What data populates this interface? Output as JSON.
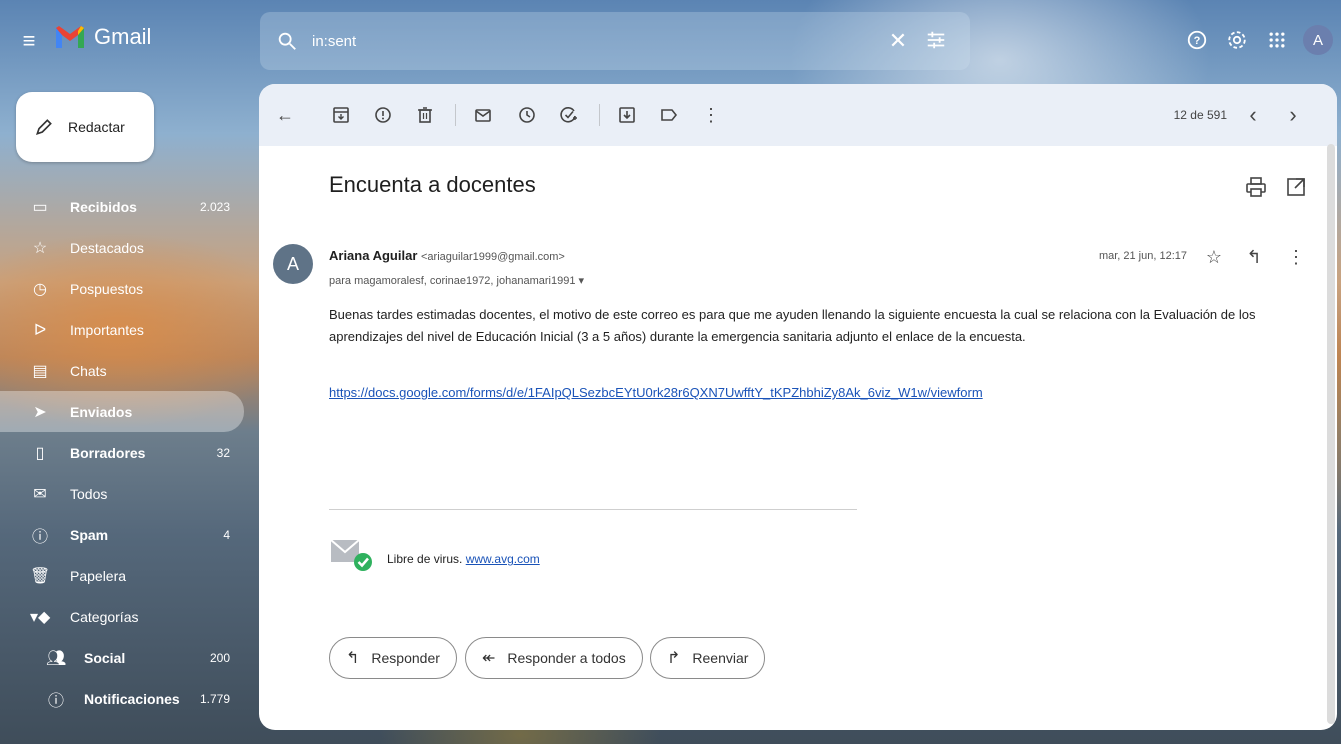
{
  "app": {
    "name": "Gmail",
    "avatar_letter": "A"
  },
  "search": {
    "value": "in:sent",
    "icon": "search-icon"
  },
  "top_icons": [
    "help-icon",
    "settings-icon",
    "apps-grid-icon"
  ],
  "compose": {
    "label": "Redactar"
  },
  "sidebar": {
    "items": [
      {
        "label": "Recibidos",
        "count": "2.023",
        "icon": "inbox-icon",
        "bold": true
      },
      {
        "label": "Destacados",
        "count": "",
        "icon": "star-icon"
      },
      {
        "label": "Pospuestos",
        "count": "",
        "icon": "clock-icon"
      },
      {
        "label": "Importantes",
        "count": "",
        "icon": "important-icon"
      },
      {
        "label": "Chats",
        "count": "",
        "icon": "chat-icon"
      },
      {
        "label": "Enviados",
        "count": "",
        "icon": "send-icon",
        "bold": true,
        "active": true
      },
      {
        "label": "Borradores",
        "count": "32",
        "icon": "draft-icon",
        "bold": true
      },
      {
        "label": "Todos",
        "count": "",
        "icon": "mail-icon"
      },
      {
        "label": "Spam",
        "count": "4",
        "icon": "spam-icon",
        "bold": true
      },
      {
        "label": "Papelera",
        "count": "",
        "icon": "trash-icon"
      },
      {
        "label": "Categorías",
        "count": "",
        "icon": "label-icon"
      },
      {
        "label": "Social",
        "count": "200",
        "icon": "people-icon",
        "sub": true
      },
      {
        "label": "Notificaciones",
        "count": "1.779",
        "icon": "info-icon",
        "sub": true
      }
    ]
  },
  "toolbar": {
    "pager": "12 de 591"
  },
  "email": {
    "subject": "Encuenta a docentes",
    "sender_initial": "A",
    "sender_name": "Ariana Aguilar",
    "sender_email": "<ariaguilar1999@gmail.com>",
    "to": "para magamoralesf, corinae1972, johanamari1991 ▾",
    "date": "mar, 21 jun, 12:17",
    "body": "Buenas tardes estimadas docentes, el motivo de este correo es para que me  ayuden llenando la siguiente encuesta la cual se relaciona con la  Evaluación de los aprendizajes del nivel de Educación Inicial (3 a 5 años) durante la emergencia sanitaria adjunto el enlace de la encuesta.",
    "link": "https://docs.google.com/forms/d/e/1FAIpQLSezbcEYtU0rk28r6QXN7UwfftY_tKPZhbhiZy8Ak_6viz_W1w/viewform",
    "virus_text": "Libre de virus.",
    "virus_link": "www.avg.com"
  },
  "actions": {
    "reply": "Responder",
    "reply_all": "Responder a todos",
    "forward": "Reenviar"
  }
}
